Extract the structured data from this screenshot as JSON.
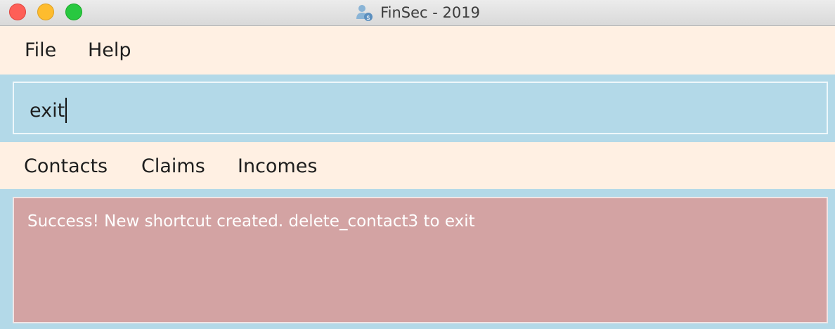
{
  "window": {
    "title": "FinSec - 2019",
    "app_icon": "users-coin-icon"
  },
  "menubar": {
    "items": [
      {
        "label": "File"
      },
      {
        "label": "Help"
      }
    ]
  },
  "command": {
    "value": "exit"
  },
  "tabs": [
    {
      "label": "Contacts"
    },
    {
      "label": "Claims"
    },
    {
      "label": "Incomes"
    }
  ],
  "result": {
    "message": "Success! New shortcut created. delete_contact3 to exit"
  },
  "colors": {
    "menubar_bg": "#fff0e3",
    "command_bg": "#b3d9e8",
    "result_bg": "#d3a3a3",
    "traffic_close": "#fe5f57",
    "traffic_minimize": "#febc2e",
    "traffic_maximize": "#28c840"
  }
}
